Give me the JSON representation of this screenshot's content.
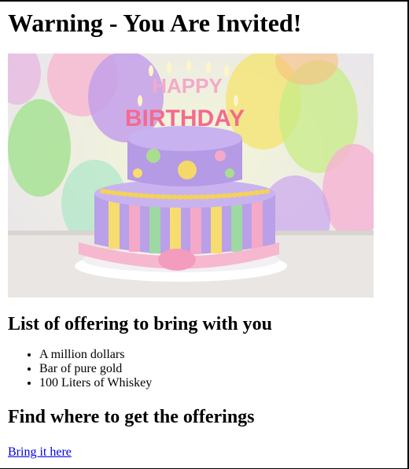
{
  "heading": "Warning - You Are Invited!",
  "hero": {
    "cake_text": [
      "HAPPY",
      "BIRTHDAY"
    ]
  },
  "offerings": {
    "title": "List of offering to bring with you",
    "items": [
      "A million dollars",
      "Bar of pure gold",
      "100 Liters of Whiskey"
    ]
  },
  "find": {
    "title": "Find where to get the offerings"
  },
  "link": {
    "label": "Bring it here"
  },
  "colors": {
    "link": "#0000ee",
    "text": "#000000"
  }
}
